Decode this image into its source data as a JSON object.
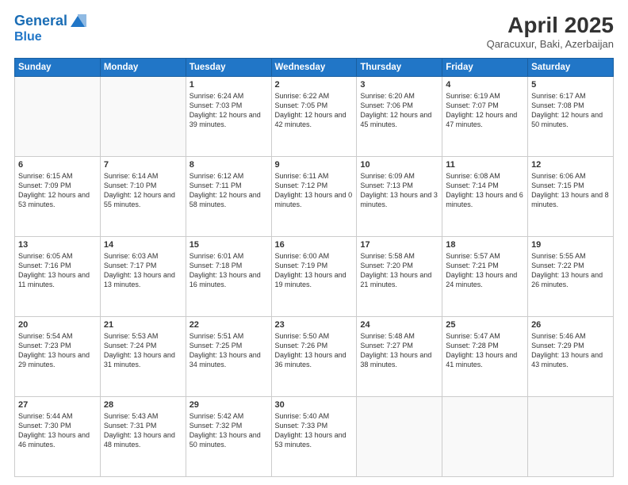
{
  "header": {
    "logo_line1": "General",
    "logo_line2": "Blue",
    "month": "April 2025",
    "location": "Qaracuxur, Baki, Azerbaijan"
  },
  "days_of_week": [
    "Sunday",
    "Monday",
    "Tuesday",
    "Wednesday",
    "Thursday",
    "Friday",
    "Saturday"
  ],
  "weeks": [
    [
      {
        "day": "",
        "info": ""
      },
      {
        "day": "",
        "info": ""
      },
      {
        "day": "1",
        "info": "Sunrise: 6:24 AM\nSunset: 7:03 PM\nDaylight: 12 hours and 39 minutes."
      },
      {
        "day": "2",
        "info": "Sunrise: 6:22 AM\nSunset: 7:05 PM\nDaylight: 12 hours and 42 minutes."
      },
      {
        "day": "3",
        "info": "Sunrise: 6:20 AM\nSunset: 7:06 PM\nDaylight: 12 hours and 45 minutes."
      },
      {
        "day": "4",
        "info": "Sunrise: 6:19 AM\nSunset: 7:07 PM\nDaylight: 12 hours and 47 minutes."
      },
      {
        "day": "5",
        "info": "Sunrise: 6:17 AM\nSunset: 7:08 PM\nDaylight: 12 hours and 50 minutes."
      }
    ],
    [
      {
        "day": "6",
        "info": "Sunrise: 6:15 AM\nSunset: 7:09 PM\nDaylight: 12 hours and 53 minutes."
      },
      {
        "day": "7",
        "info": "Sunrise: 6:14 AM\nSunset: 7:10 PM\nDaylight: 12 hours and 55 minutes."
      },
      {
        "day": "8",
        "info": "Sunrise: 6:12 AM\nSunset: 7:11 PM\nDaylight: 12 hours and 58 minutes."
      },
      {
        "day": "9",
        "info": "Sunrise: 6:11 AM\nSunset: 7:12 PM\nDaylight: 13 hours and 0 minutes."
      },
      {
        "day": "10",
        "info": "Sunrise: 6:09 AM\nSunset: 7:13 PM\nDaylight: 13 hours and 3 minutes."
      },
      {
        "day": "11",
        "info": "Sunrise: 6:08 AM\nSunset: 7:14 PM\nDaylight: 13 hours and 6 minutes."
      },
      {
        "day": "12",
        "info": "Sunrise: 6:06 AM\nSunset: 7:15 PM\nDaylight: 13 hours and 8 minutes."
      }
    ],
    [
      {
        "day": "13",
        "info": "Sunrise: 6:05 AM\nSunset: 7:16 PM\nDaylight: 13 hours and 11 minutes."
      },
      {
        "day": "14",
        "info": "Sunrise: 6:03 AM\nSunset: 7:17 PM\nDaylight: 13 hours and 13 minutes."
      },
      {
        "day": "15",
        "info": "Sunrise: 6:01 AM\nSunset: 7:18 PM\nDaylight: 13 hours and 16 minutes."
      },
      {
        "day": "16",
        "info": "Sunrise: 6:00 AM\nSunset: 7:19 PM\nDaylight: 13 hours and 19 minutes."
      },
      {
        "day": "17",
        "info": "Sunrise: 5:58 AM\nSunset: 7:20 PM\nDaylight: 13 hours and 21 minutes."
      },
      {
        "day": "18",
        "info": "Sunrise: 5:57 AM\nSunset: 7:21 PM\nDaylight: 13 hours and 24 minutes."
      },
      {
        "day": "19",
        "info": "Sunrise: 5:55 AM\nSunset: 7:22 PM\nDaylight: 13 hours and 26 minutes."
      }
    ],
    [
      {
        "day": "20",
        "info": "Sunrise: 5:54 AM\nSunset: 7:23 PM\nDaylight: 13 hours and 29 minutes."
      },
      {
        "day": "21",
        "info": "Sunrise: 5:53 AM\nSunset: 7:24 PM\nDaylight: 13 hours and 31 minutes."
      },
      {
        "day": "22",
        "info": "Sunrise: 5:51 AM\nSunset: 7:25 PM\nDaylight: 13 hours and 34 minutes."
      },
      {
        "day": "23",
        "info": "Sunrise: 5:50 AM\nSunset: 7:26 PM\nDaylight: 13 hours and 36 minutes."
      },
      {
        "day": "24",
        "info": "Sunrise: 5:48 AM\nSunset: 7:27 PM\nDaylight: 13 hours and 38 minutes."
      },
      {
        "day": "25",
        "info": "Sunrise: 5:47 AM\nSunset: 7:28 PM\nDaylight: 13 hours and 41 minutes."
      },
      {
        "day": "26",
        "info": "Sunrise: 5:46 AM\nSunset: 7:29 PM\nDaylight: 13 hours and 43 minutes."
      }
    ],
    [
      {
        "day": "27",
        "info": "Sunrise: 5:44 AM\nSunset: 7:30 PM\nDaylight: 13 hours and 46 minutes."
      },
      {
        "day": "28",
        "info": "Sunrise: 5:43 AM\nSunset: 7:31 PM\nDaylight: 13 hours and 48 minutes."
      },
      {
        "day": "29",
        "info": "Sunrise: 5:42 AM\nSunset: 7:32 PM\nDaylight: 13 hours and 50 minutes."
      },
      {
        "day": "30",
        "info": "Sunrise: 5:40 AM\nSunset: 7:33 PM\nDaylight: 13 hours and 53 minutes."
      },
      {
        "day": "",
        "info": ""
      },
      {
        "day": "",
        "info": ""
      },
      {
        "day": "",
        "info": ""
      }
    ]
  ]
}
